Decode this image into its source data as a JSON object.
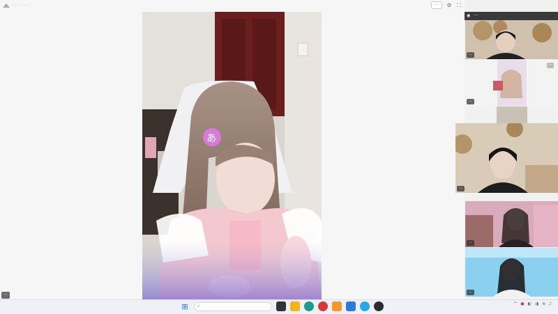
{
  "titlebar": {
    "title": "·  ·  ·  ·  ·  ·",
    "right_pill": "···",
    "controls": [
      "settings-icon",
      "fullscreen-icon"
    ]
  },
  "main_label": "···",
  "side_header": "···",
  "tiles": [
    {
      "label": "···"
    },
    {
      "label": "···"
    },
    {
      "label": "···"
    },
    {
      "label": "···"
    },
    {
      "label": "···"
    }
  ],
  "taskbar": {
    "left_text_1": "",
    "left_text_2": "",
    "search_placeholder": "",
    "clock_time": "",
    "clock_date": ""
  },
  "colors": {
    "accent": "#0078d4",
    "taskbar_bg": "#eef0f6",
    "side_header_bg": "#3a3a3a"
  }
}
